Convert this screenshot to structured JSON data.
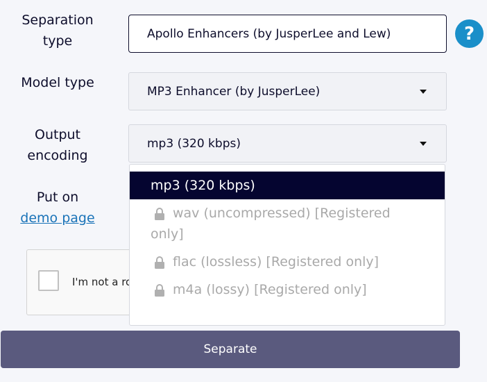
{
  "form": {
    "separation_type": {
      "label_line1": "Separation",
      "label_line2": "type",
      "value": "Apollo Enhancers (by JusperLee and Lew)"
    },
    "model_type": {
      "label": "Model type",
      "value": "MP3 Enhancer (by JusperLee)"
    },
    "output_encoding": {
      "label_line1": "Output",
      "label_line2": "encoding",
      "value": "mp3 (320 kbps)"
    },
    "demo": {
      "label_line1": "Put on",
      "link": "demo page"
    },
    "help_icon": "?"
  },
  "captcha": {
    "text": "I'm not a ro"
  },
  "dropdown": {
    "options": [
      {
        "label": "mp3 (320 kbps)",
        "selected": true,
        "locked": false
      },
      {
        "label_line1": "wav (uncompressed) [Registered",
        "label_line2": "only]",
        "selected": false,
        "locked": true
      },
      {
        "label": "flac (lossless) [Registered only]",
        "selected": false,
        "locked": true
      },
      {
        "label": "m4a (lossy) [Registered only]",
        "selected": false,
        "locked": true
      }
    ]
  },
  "buttons": {
    "separate": "Separate"
  },
  "colors": {
    "accent": "#050530",
    "button": "#5a5a7e",
    "help": "#1a8fc9",
    "link": "#1a73b8",
    "disabled_text": "#a9a9a9"
  }
}
